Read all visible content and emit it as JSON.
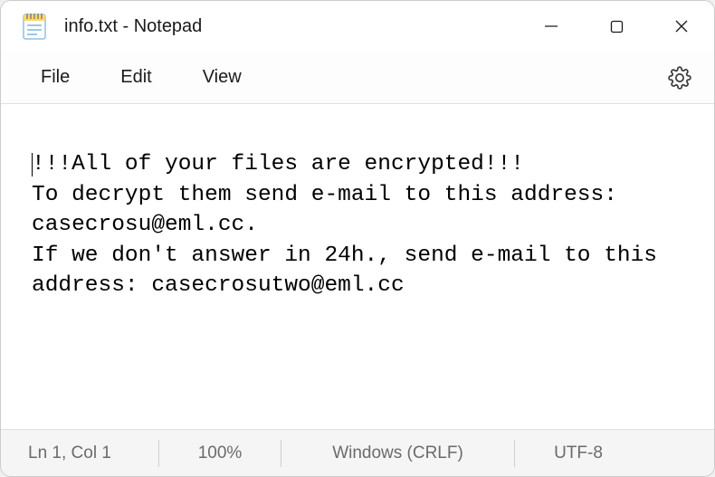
{
  "window": {
    "title": "info.txt - Notepad"
  },
  "menu": {
    "file": "File",
    "edit": "Edit",
    "view": "View"
  },
  "content": {
    "text": "!!!All of your files are encrypted!!!\nTo decrypt them send e-mail to this address: casecrosu@eml.cc.\nIf we don't answer in 24h., send e-mail to this address: casecrosutwo@eml.cc"
  },
  "status": {
    "position": "Ln 1, Col 1",
    "zoom": "100%",
    "lineending": "Windows (CRLF)",
    "encoding": "UTF-8"
  }
}
